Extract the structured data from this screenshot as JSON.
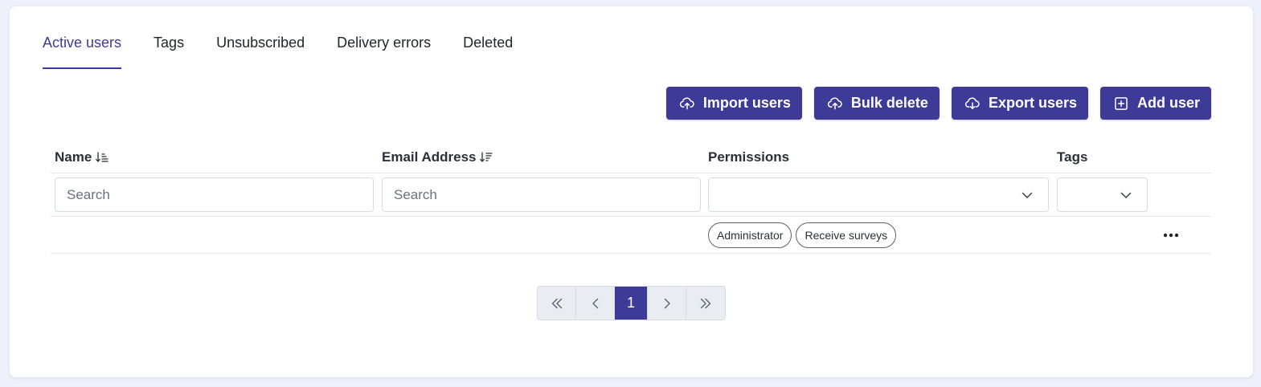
{
  "tabs": [
    {
      "label": "Active users",
      "active": true
    },
    {
      "label": "Tags",
      "active": false
    },
    {
      "label": "Unsubscribed",
      "active": false
    },
    {
      "label": "Delivery errors",
      "active": false
    },
    {
      "label": "Deleted",
      "active": false
    }
  ],
  "toolbar": {
    "import_label": "Import users",
    "import_icon": "cloud-upload-icon",
    "bulk_delete_label": "Bulk delete",
    "bulk_delete_icon": "cloud-upload-icon",
    "export_label": "Export users",
    "export_icon": "cloud-download-icon",
    "add_label": "Add user",
    "add_icon": "plus-square-icon"
  },
  "table": {
    "columns": {
      "name": "Name",
      "email": "Email Address",
      "permissions": "Permissions",
      "tags": "Tags"
    },
    "filters": {
      "name_placeholder": "Search",
      "email_placeholder": "Search"
    },
    "rows": [
      {
        "name": "",
        "email": "",
        "permissions": [
          "Administrator",
          "Receive surveys"
        ],
        "tags": ""
      }
    ]
  },
  "pagination": {
    "current_page": "1"
  },
  "colors": {
    "accent": "#3d3a98",
    "background": "#eef1f9",
    "card": "#ffffff"
  }
}
